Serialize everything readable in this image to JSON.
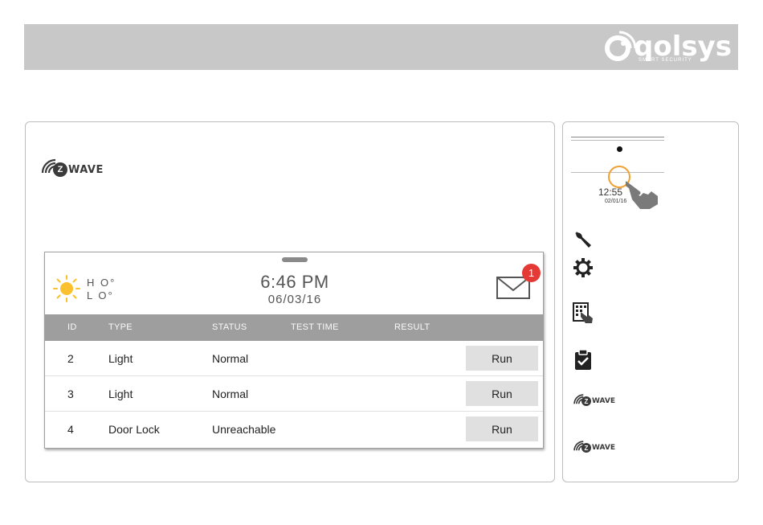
{
  "brand": {
    "logo_text": "qolsys",
    "logo_sub": "SMART SECURITY"
  },
  "zwave": {
    "z_letter": "Z",
    "wave_text": "WAVE"
  },
  "panel": {
    "weather": {
      "hi": "H O°",
      "lo": "L O°"
    },
    "time": "6:46 PM",
    "date": "06/03/16",
    "message_count": "1"
  },
  "table": {
    "headers": [
      "ID",
      "TYPE",
      "STATUS",
      "TEST TIME",
      "RESULT"
    ],
    "rows": [
      {
        "id": "2",
        "type": "Light",
        "status": "Normal",
        "test_time": "",
        "result": "",
        "action": "Run"
      },
      {
        "id": "3",
        "type": "Light",
        "status": "Normal",
        "test_time": "",
        "result": "",
        "action": "Run"
      },
      {
        "id": "4",
        "type": "Door Lock",
        "status": "Unreachable",
        "test_time": "",
        "result": "",
        "action": "Run"
      }
    ]
  },
  "sidebar": {
    "mini_time": "12:55",
    "mini_date": "02/01/16",
    "icons": [
      "wrench-icon",
      "gear-icon",
      "touch-grid-icon",
      "clipboard-check-icon",
      "zwave-icon",
      "zwave-icon"
    ]
  },
  "colors": {
    "topbar": "#c8c8c8",
    "table_header": "#9e9e9e",
    "badge": "#e53935",
    "accent_ring": "#f0a030",
    "sun": "#fbc02d"
  }
}
